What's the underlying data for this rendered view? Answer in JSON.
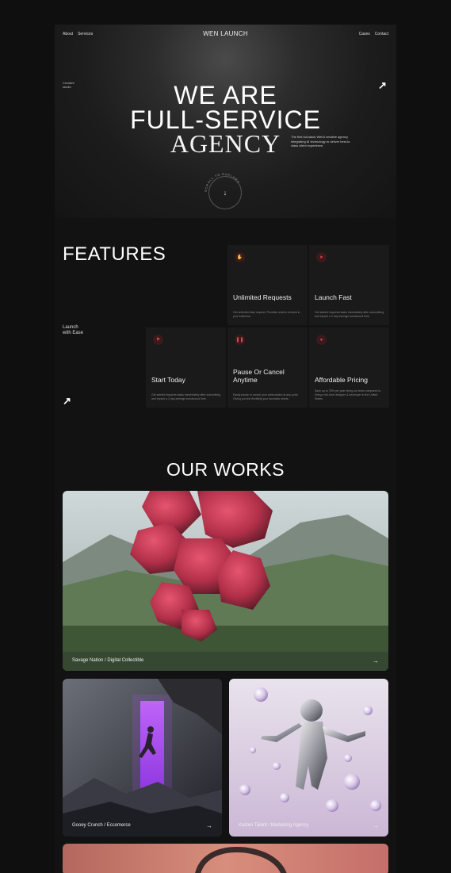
{
  "nav": {
    "left": [
      "About",
      "Services"
    ],
    "brand": "WEN LAUNCH",
    "right": [
      "Cases",
      "Contact"
    ]
  },
  "hero": {
    "tag": [
      "Creative",
      "studio"
    ],
    "line1": "WE ARE",
    "line2": "FULL-SERVICE",
    "line3": "AGENCY",
    "description": "The first full-stack Web3 creative agency integrating AI technology to deliver best-in-class client experience.",
    "scroll_badge": "SCROLL TO EXPLORE"
  },
  "features": {
    "title": "FEATURES",
    "side_label": [
      "Launch",
      "with Ease"
    ],
    "cards": [
      {
        "icon": "hand-icon",
        "title": "Unlimited Requests",
        "desc": "Get unlimited task request. Prioritize what is needed in your business."
      },
      {
        "icon": "rocket-icon",
        "title": "Launch Fast",
        "desc": "Get started requests tasks immediately after subscribing and expect a 2 day average turnaround time."
      },
      {
        "icon": "flag-icon",
        "title": "Start Today",
        "desc": "Get started requests tasks immediately after subscribing and expect a 2 day average turnaround time."
      },
      {
        "icon": "pause-icon",
        "title": "Pause Or Cancel Anytime",
        "desc": "Easily pause or cancel your subscription at any point. Giving you the flexibility your business needs."
      },
      {
        "icon": "piggy-bank-icon",
        "title": "Affordable Pricing",
        "desc": "Save up to 78% per year hiring our team compared to hiring a full-time designer & developer in the United States."
      }
    ]
  },
  "works": {
    "title": "OUR WORKS",
    "items": [
      {
        "caption": "Savage Nation / Digital Collectible"
      },
      {
        "caption": "Gooey Crunch / Eccomerce"
      },
      {
        "caption": "Kaizen Talent / Marketing Agency"
      }
    ]
  },
  "colors": {
    "accent": "#e0454f",
    "bg": "#121212",
    "card": "#1a1a1a"
  }
}
